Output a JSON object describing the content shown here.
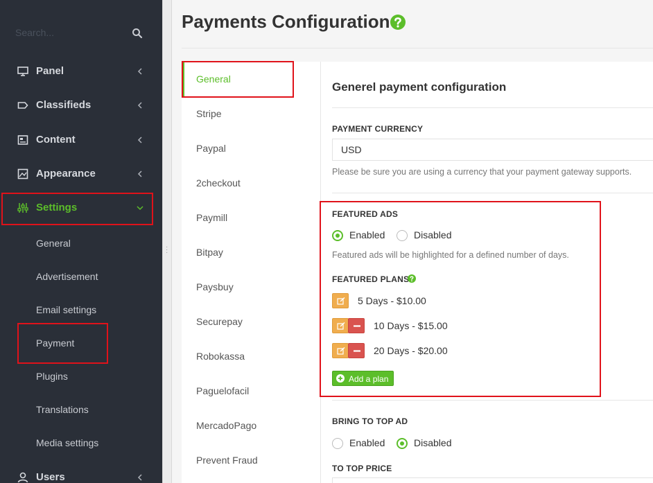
{
  "sidebar": {
    "search_placeholder": "Search...",
    "items": [
      {
        "label": "Panel",
        "icon": "monitor-icon"
      },
      {
        "label": "Classifieds",
        "icon": "tag-icon"
      },
      {
        "label": "Content",
        "icon": "document-icon"
      },
      {
        "label": "Appearance",
        "icon": "image-icon"
      },
      {
        "label": "Settings",
        "icon": "sliders-icon",
        "active": true
      },
      {
        "label": "Users",
        "icon": "user-icon"
      }
    ],
    "settings_sub": [
      "General",
      "Advertisement",
      "Email settings",
      "Payment",
      "Plugins",
      "Translations",
      "Media settings"
    ]
  },
  "main": {
    "title": "Payments Configuration",
    "tabs": [
      "General",
      "Stripe",
      "Paypal",
      "2checkout",
      "Paymill",
      "Bitpay",
      "Paysbuy",
      "Securepay",
      "Robokassa",
      "Paguelofacil",
      "MercadoPago",
      "Prevent Fraud"
    ],
    "panel": {
      "title": "Generel payment configuration",
      "currency_label": "PAYMENT CURRENCY",
      "currency_value": "USD",
      "currency_help": "Please be sure you are using a currency that your payment gateway supports.",
      "featured_label": "FEATURED ADS",
      "enabled": "Enabled",
      "disabled": "Disabled",
      "featured_help": "Featured ads will be highlighted for a defined number of days.",
      "plans_label": "FEATURED PLANS",
      "plans": [
        "5 Days - $10.00",
        "10 Days - $15.00",
        "20 Days - $20.00"
      ],
      "add_plan": "Add a plan",
      "bring_label": "BRING TO TOP AD",
      "to_top_label": "TO TOP PRICE"
    }
  },
  "colors": {
    "accent": "#5cbe2a",
    "sidebar_bg": "#2a2f38",
    "highlight_box": "#e0121a",
    "edit_button": "#f0ad4e",
    "delete_button": "#d9534f"
  }
}
